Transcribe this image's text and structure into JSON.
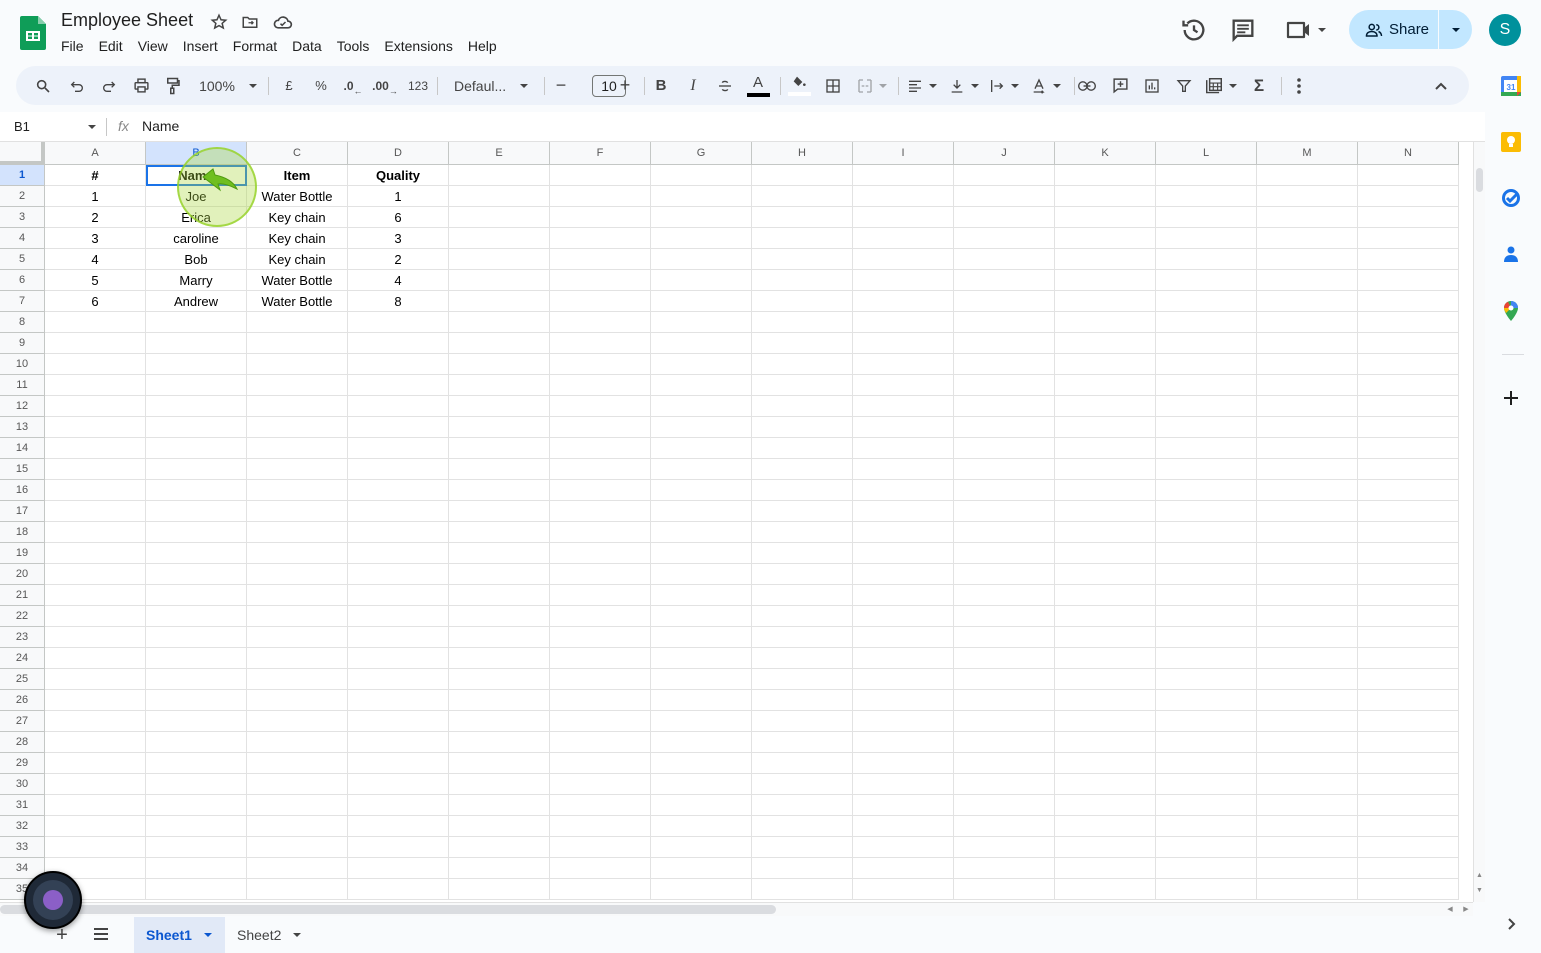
{
  "app": {
    "title": "Employee Sheet",
    "menu": [
      "File",
      "Edit",
      "View",
      "Insert",
      "Format",
      "Data",
      "Tools",
      "Extensions",
      "Help"
    ],
    "share_label": "Share",
    "avatar_letter": "S"
  },
  "toolbar": {
    "zoom": "100%",
    "currency": "£",
    "percent": "%",
    "decrease_decimal": ".0",
    "increase_decimal": ".00",
    "number_format": "123",
    "font": "Defaul...",
    "font_size": "10",
    "bold": "B",
    "italic": "I",
    "text_color": "A",
    "sum": "Σ"
  },
  "formula_bar": {
    "name_box": "B1",
    "fx": "fx",
    "value": "Name"
  },
  "grid": {
    "columns": [
      "A",
      "B",
      "C",
      "D",
      "E",
      "F",
      "G",
      "H",
      "I",
      "J",
      "K",
      "L",
      "M",
      "N"
    ],
    "selected_cell": "B1",
    "header_row": [
      "#",
      "Name",
      "Item",
      "Quality"
    ],
    "rows": [
      [
        "1",
        "Joe",
        "Water Bottle",
        "1"
      ],
      [
        "2",
        "Erica",
        "Key chain",
        "6"
      ],
      [
        "3",
        "caroline",
        "Key chain",
        "3"
      ],
      [
        "4",
        "Bob",
        "Key chain",
        "2"
      ],
      [
        "5",
        "Marry",
        "Water Bottle",
        "4"
      ],
      [
        "6",
        "Andrew",
        "Water Bottle",
        "8"
      ]
    ],
    "row_count_visible": 35
  },
  "sheets": [
    {
      "name": "Sheet1",
      "active": true
    },
    {
      "name": "Sheet2",
      "active": false
    }
  ],
  "colors": {
    "accent": "#0b57d0",
    "share_bg": "#c2e7ff",
    "avatar": "#00919c",
    "sheets_green": "#0f9d58"
  }
}
